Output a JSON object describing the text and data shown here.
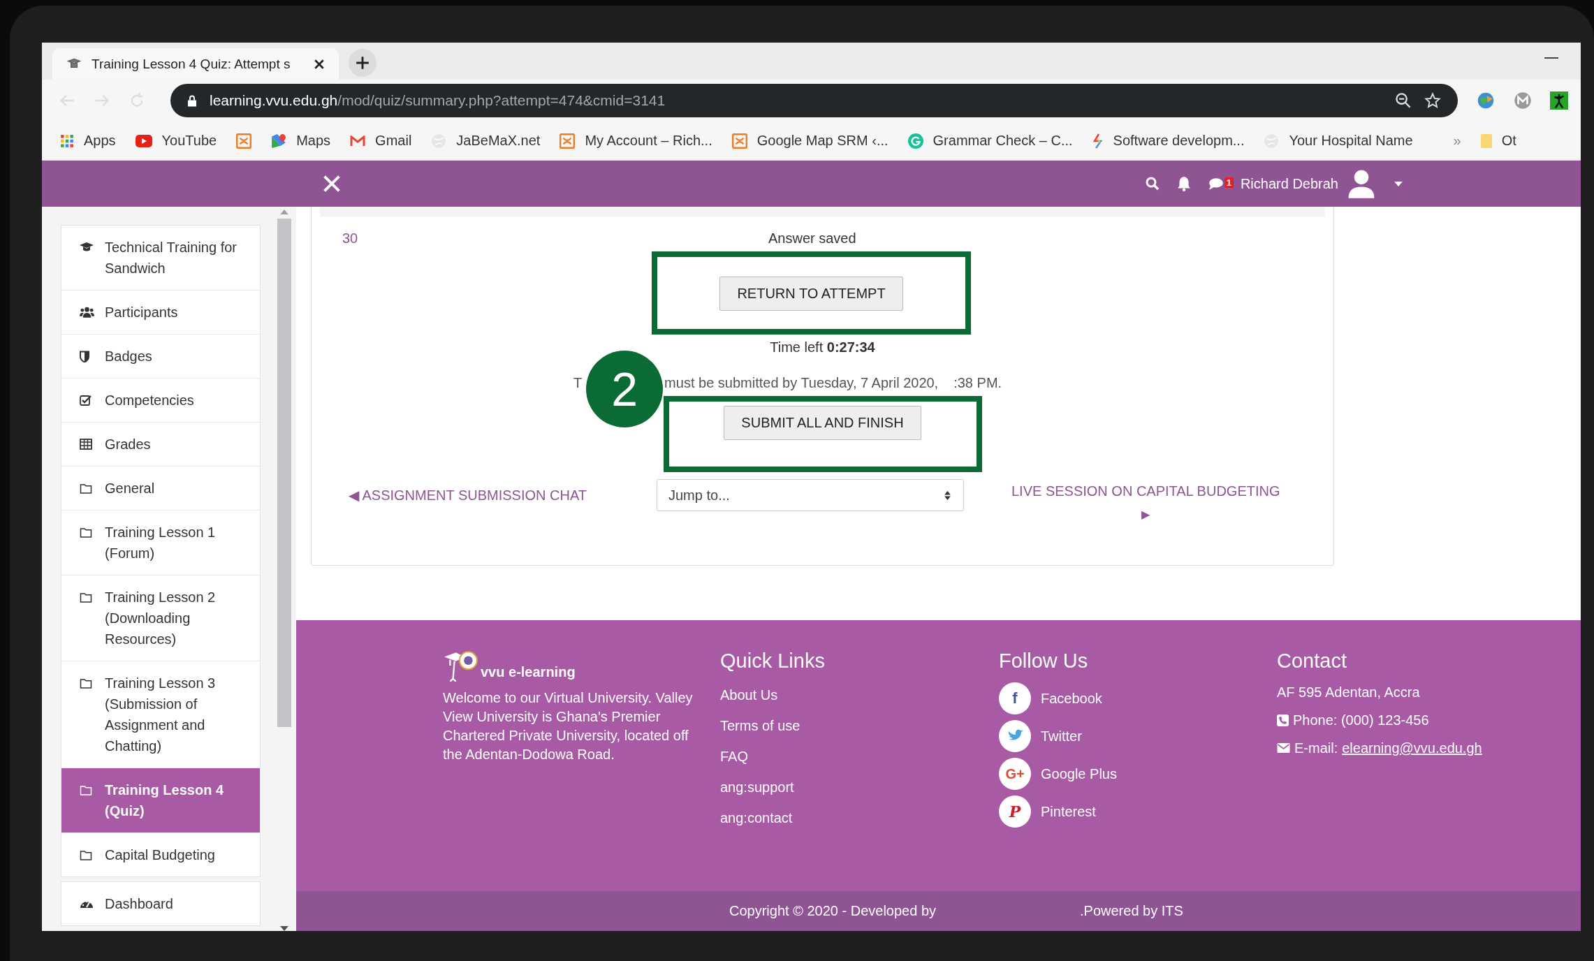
{
  "browser": {
    "tab": {
      "title": "Training Lesson 4 Quiz: Attempt s",
      "selected": true
    },
    "url": {
      "domain": "learning.vvu.edu.gh",
      "path": "/mod/quiz/summary.php?attempt=474&cmid=3141"
    },
    "bookmarks": [
      {
        "kind": "apps",
        "label": "Apps"
      },
      {
        "kind": "youtube",
        "label": "YouTube"
      },
      {
        "kind": "xampp"
      },
      {
        "kind": "maps",
        "label": "Maps"
      },
      {
        "kind": "gmail",
        "label": "Gmail"
      },
      {
        "kind": "globe",
        "label": "JaBeMaX.net"
      },
      {
        "kind": "xampp",
        "label": "My Account – Rich..."
      },
      {
        "kind": "xampp",
        "label": "Google Map SRM ‹..."
      },
      {
        "kind": "grammarly",
        "label": "Grammar Check – C..."
      },
      {
        "kind": "software",
        "label": "Software developm..."
      },
      {
        "kind": "globe",
        "label": "Your Hospital Name"
      }
    ],
    "bookmarks_overflow": "»",
    "other_bookmarks": "Ot"
  },
  "navbar": {
    "user_name": "Richard Debrah",
    "message_count": "1"
  },
  "sidebar": {
    "items": [
      {
        "kind": "course",
        "label": "Technical Training for Sandwich",
        "selected": false
      },
      {
        "kind": "participants",
        "label": "Participants",
        "selected": false
      },
      {
        "kind": "badges",
        "label": "Badges",
        "selected": false
      },
      {
        "kind": "competencies",
        "label": "Competencies",
        "selected": false
      },
      {
        "kind": "grades",
        "label": "Grades",
        "selected": false
      },
      {
        "kind": "folder",
        "label": "General",
        "selected": false
      },
      {
        "kind": "folder",
        "label": "Training Lesson 1 (Forum)",
        "selected": false
      },
      {
        "kind": "folder",
        "label": "Training Lesson 2 (Downloading Resources)",
        "selected": false
      },
      {
        "kind": "folder",
        "label": "Training Lesson 3 (Submission of Assignment and Chatting)",
        "selected": false
      },
      {
        "kind": "folder",
        "label": "Training Lesson 4 (Quiz)",
        "selected": true
      },
      {
        "kind": "folder",
        "label": "Capital Budgeting",
        "selected": false
      }
    ],
    "extra_items": [
      {
        "kind": "dashboard",
        "label": "Dashboard",
        "selected": false
      }
    ]
  },
  "quiz": {
    "question_number": "30",
    "status": "Answer saved",
    "return_button": "RETURN TO ATTEMPT",
    "time_left": "Time left **0:27:34**",
    "deadline_parts": [
      "T",
      "must be submitted by Tuesday, 7 April 2020,",
      ":38 PM."
    ],
    "submit_button": "SUBMIT ALL AND FINISH",
    "step_number": "2",
    "prev_link": "◀ ASSIGNMENT SUBMISSION CHAT",
    "jump_placeholder": "Jump to...",
    "next_link": "LIVE SESSION ON CAPITAL BUDGETING",
    "next_arrow": "▶"
  },
  "footer": {
    "logo_text": "vvu e-learning",
    "about": "Welcome to our Virtual University. Valley View University is Ghana's Premier Chartered Private University, located off the Adentan-Dodowa Road.",
    "quick_links": {
      "title": "Quick Links",
      "items": [
        "About Us",
        "Terms of use",
        "FAQ",
        "ang:support",
        "ang:contact"
      ]
    },
    "follow": {
      "title": "Follow Us",
      "items": [
        {
          "kind": "facebook",
          "glyph": "f",
          "label": "Facebook"
        },
        {
          "kind": "twitter",
          "label": "Twitter"
        },
        {
          "kind": "googleplus",
          "glyph": "G+",
          "label": "Google Plus"
        },
        {
          "kind": "pinterest",
          "glyph": "P",
          "label": "Pinterest"
        }
      ]
    },
    "contact": {
      "title": "Contact",
      "address": "AF 595 Adentan, Accra",
      "phone": "Phone: (000) 123-456",
      "email_label": "E-mail:",
      "email": "elearning@vvu.edu.gh"
    },
    "copyright": "Copyright © 2020 - Developed by",
    "powered": ".Powered by ITS"
  }
}
